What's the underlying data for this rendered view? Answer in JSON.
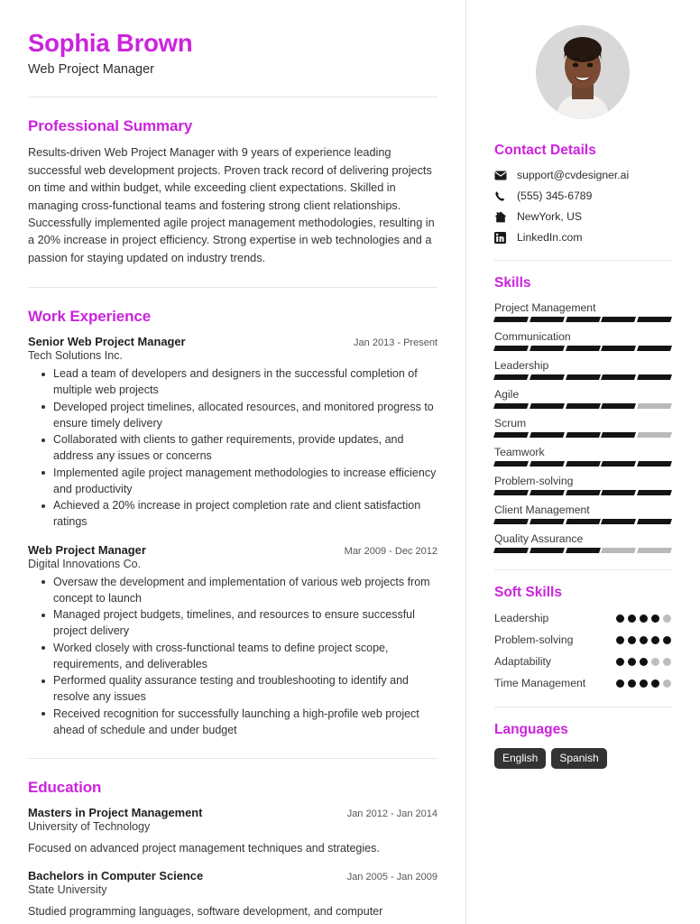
{
  "theme": {
    "accent": "#cc23dd",
    "bar_on": "#141414",
    "bar_off": "#b9b9b9",
    "pill_bg": "#333333"
  },
  "header": {
    "name": "Sophia Brown",
    "job_title": "Web Project Manager"
  },
  "summary": {
    "title": "Professional Summary",
    "text": "Results-driven Web Project Manager with 9 years of experience leading successful web development projects. Proven track record of delivering projects on time and within budget, while exceeding client expectations. Skilled in managing cross-functional teams and fostering strong client relationships. Successfully implemented agile project management methodologies, resulting in a 20% increase in project efficiency. Strong expertise in web technologies and a passion for staying updated on industry trends."
  },
  "work": {
    "title": "Work Experience",
    "jobs": [
      {
        "role": "Senior Web Project Manager",
        "dates": "Jan 2013 - Present",
        "company": "Tech Solutions Inc.",
        "bullets": [
          "Lead a team of developers and designers in the successful completion of multiple web projects",
          "Developed project timelines, allocated resources, and monitored progress to ensure timely delivery",
          "Collaborated with clients to gather requirements, provide updates, and address any issues or concerns",
          "Implemented agile project management methodologies to increase efficiency and productivity",
          "Achieved a 20% increase in project completion rate and client satisfaction ratings"
        ]
      },
      {
        "role": "Web Project Manager",
        "dates": "Mar 2009 - Dec 2012",
        "company": "Digital Innovations Co.",
        "bullets": [
          "Oversaw the development and implementation of various web projects from concept to launch",
          "Managed project budgets, timelines, and resources to ensure successful project delivery",
          "Worked closely with cross-functional teams to define project scope, requirements, and deliverables",
          "Performed quality assurance testing and troubleshooting to identify and resolve any issues",
          "Received recognition for successfully launching a high-profile web project ahead of schedule and under budget"
        ]
      }
    ]
  },
  "education": {
    "title": "Education",
    "entries": [
      {
        "degree": "Masters in Project Management",
        "dates": "Jan 2012 - Jan 2014",
        "school": "University of Technology",
        "description": "Focused on advanced project management techniques and strategies."
      },
      {
        "degree": "Bachelors in Computer Science",
        "dates": "Jan 2005 - Jan 2009",
        "school": "State University",
        "description": "Studied programming languages, software development, and computer"
      }
    ]
  },
  "contact": {
    "title": "Contact Details",
    "items": [
      {
        "icon": "envelope-icon",
        "value": "support@cvdesigner.ai"
      },
      {
        "icon": "phone-icon",
        "value": "(555) 345-6789"
      },
      {
        "icon": "home-icon",
        "value": "NewYork, US"
      },
      {
        "icon": "linkedin-icon",
        "value": "LinkedIn.com"
      }
    ]
  },
  "skills": {
    "title": "Skills",
    "max": 5,
    "items": [
      {
        "name": "Project Management",
        "level": 5
      },
      {
        "name": "Communication",
        "level": 5
      },
      {
        "name": "Leadership",
        "level": 5
      },
      {
        "name": "Agile",
        "level": 4
      },
      {
        "name": "Scrum",
        "level": 4
      },
      {
        "name": "Teamwork",
        "level": 5
      },
      {
        "name": "Problem-solving",
        "level": 5
      },
      {
        "name": "Client Management",
        "level": 5
      },
      {
        "name": "Quality Assurance",
        "level": 3
      }
    ]
  },
  "soft_skills": {
    "title": "Soft Skills",
    "max": 5,
    "items": [
      {
        "name": "Leadership",
        "level": 4
      },
      {
        "name": "Problem-solving",
        "level": 5
      },
      {
        "name": "Adaptability",
        "level": 3
      },
      {
        "name": "Time Management",
        "level": 4
      }
    ]
  },
  "languages": {
    "title": "Languages",
    "items": [
      "English",
      "Spanish"
    ]
  }
}
